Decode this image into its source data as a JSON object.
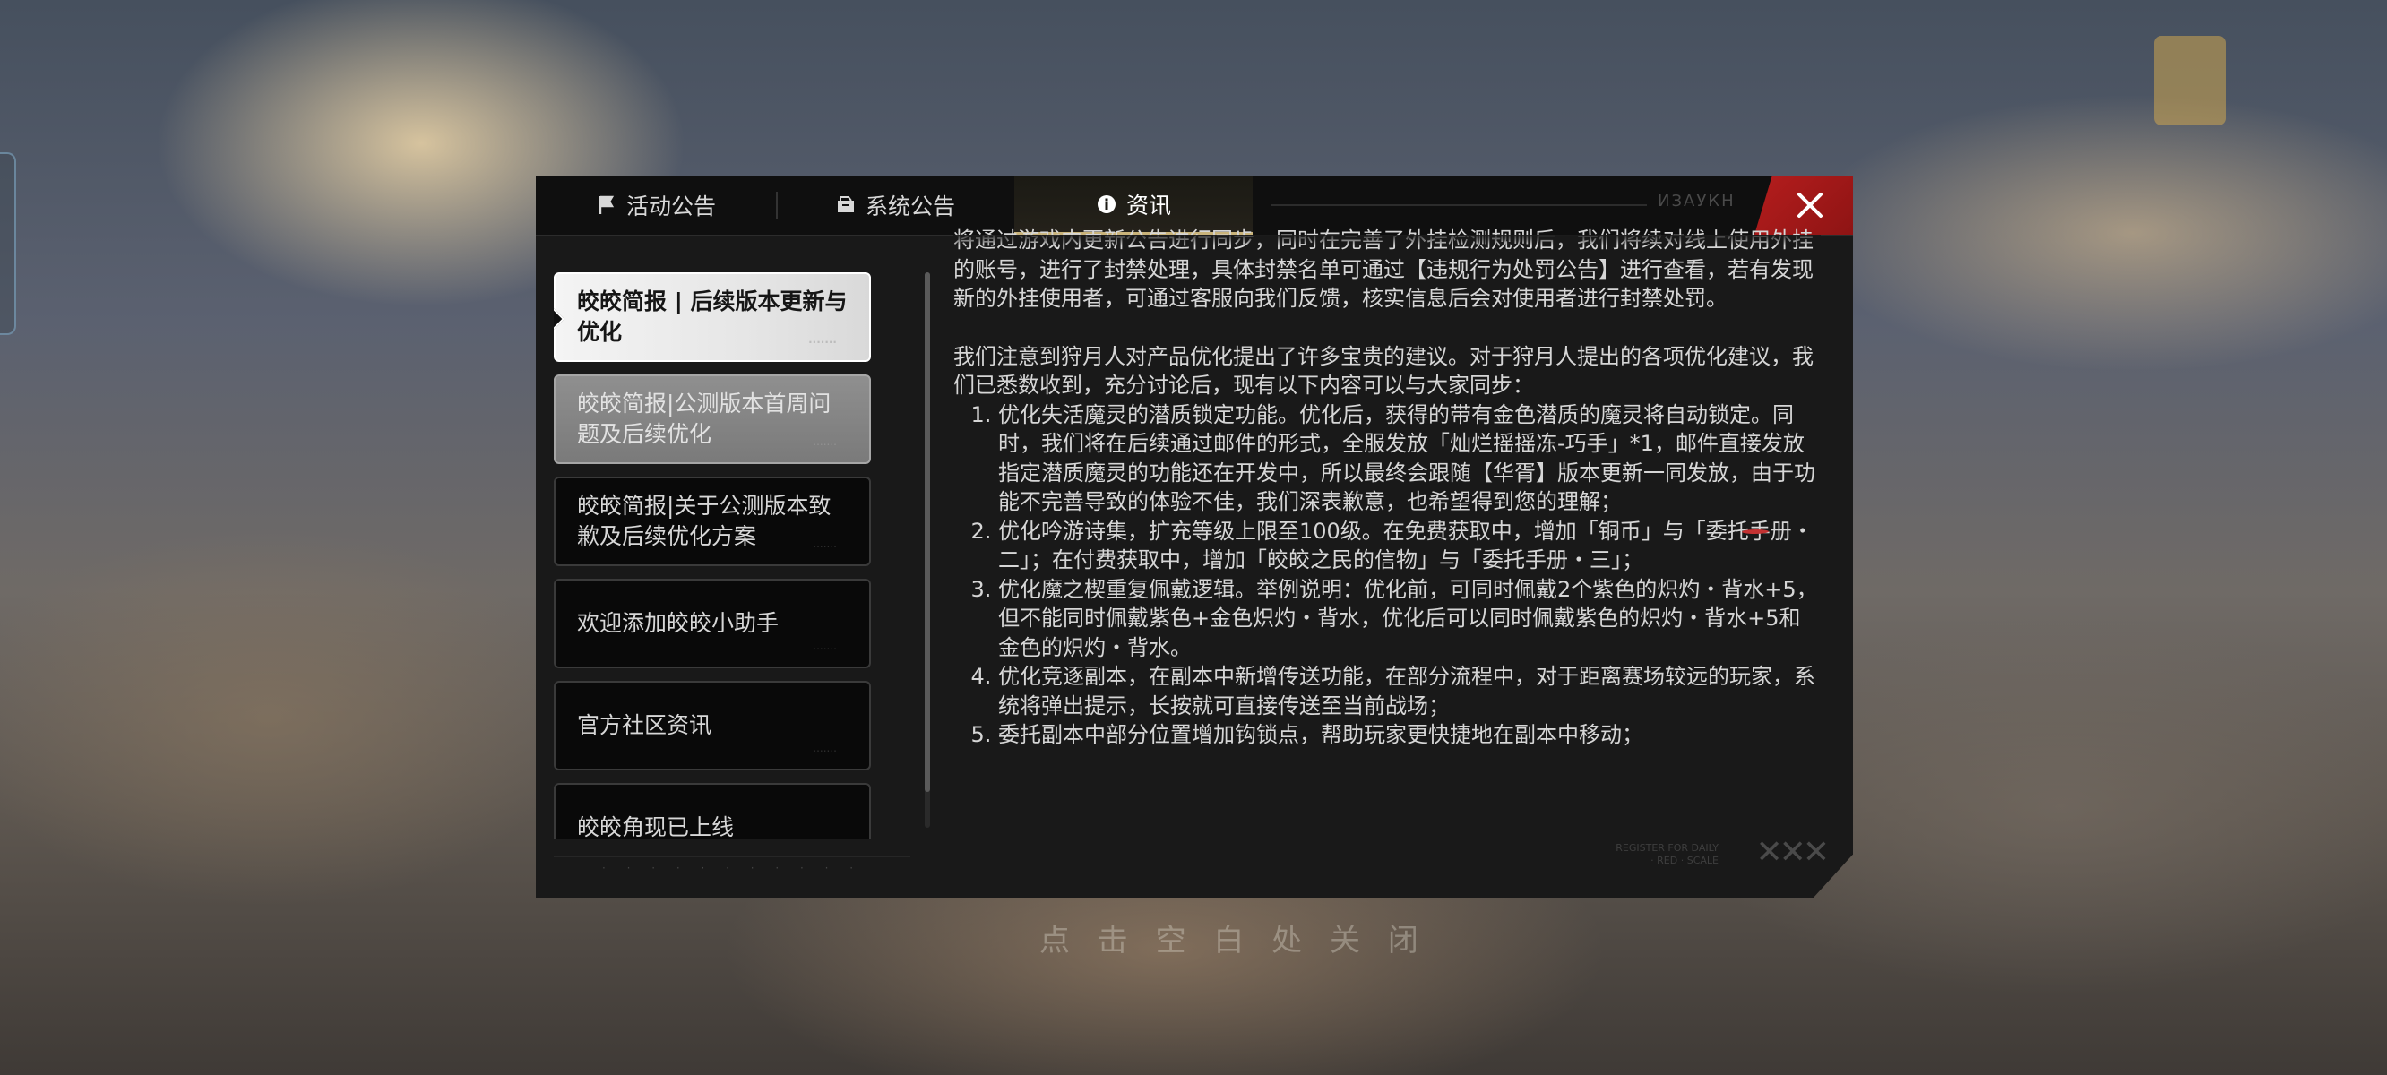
{
  "background": {
    "dim_label": "点 击 空 白 处 关 闭"
  },
  "tabs": [
    {
      "label": "活动公告",
      "icon": "flag-icon"
    },
    {
      "label": "系统公告",
      "icon": "envelope-icon"
    },
    {
      "label": "资讯",
      "icon": "info-icon",
      "active": true
    }
  ],
  "tab_deco_text": "ИЗАУКН",
  "close_icon": "close-icon",
  "list": {
    "items": [
      {
        "title": "皎皎简报 | 后续版本更新与优化",
        "state": "active"
      },
      {
        "title": "皎皎简报|公测版本首周问题及后续优化",
        "state": "read"
      },
      {
        "title": "皎皎简报|关于公测版本致歉及后续优化方案",
        "state": "normal"
      },
      {
        "title": "欢迎添加皎皎小助手",
        "state": "normal"
      },
      {
        "title": "官方社区资讯",
        "state": "normal"
      },
      {
        "title": "皎皎角现已上线",
        "state": "normal"
      }
    ],
    "footer_deco": "· · · · · · · · · · ·"
  },
  "content": {
    "para1": "将通过游戏内更新公告进行同步，同时在完善了外挂检测规则后，我们将续对线上使用外挂的账号，进行了封禁处理，具体封禁名单可通过【违规行为处罚公告】进行查看，若有发现新的外挂使用者，可通过客服向我们反馈，核实信息后会对使用者进行封禁处罚。",
    "para2": "我们注意到狩月人对产品优化提出了许多宝贵的建议。对于狩月人提出的各项优化建议，我们已悉数收到，充分讨论后，现有以下内容可以与大家同步：",
    "items": [
      {
        "before": "优化失活魔灵的潜质锁定功能。优化后，获得的带有金色潜质的魔灵将自动锁定。同时，我们将在后续通过邮件的形式，全服发放「灿烂摇摇冻-巧手」*1，邮件直接发放指定潜质魔灵的功能还在开发中，所以最终会跟随【华胥】版本更新一同发放，",
        "highlight": "由于功能不完善导致的体验不佳",
        "after": "，我们深表歉意，也希望得到您的理解；"
      },
      {
        "text": "优化吟游诗集，扩充等级上限至100级。在免费获取中，增加「铜币」与「委托手册・二」；在付费获取中，增加「皎皎之民的信物」与「委托手册・三」；"
      },
      {
        "text": "优化魔之楔重复佩戴逻辑。举例说明：优化前，可同时佩戴2个紫色的炽灼・背水+5，但不能同时佩戴紫色+金色炽灼・背水，优化后可以同时佩戴紫色的炽灼・背水+5和金色的炽灼・背水。"
      },
      {
        "text": "优化竞逐副本，在副本中新增传送功能，在部分流程中，对于距离赛场较远的玩家，系统将弹出提示，长按就可直接传送至当前战场；"
      },
      {
        "text": "委托副本中部分位置增加钩锁点，帮助玩家更快捷地在副本中移动；"
      }
    ]
  },
  "footer_deco": "REGISTER FOR DAILY · RED · SCALE",
  "colors": {
    "accent_gold": "#c9b37a",
    "close_red": "#b51d1d",
    "underline_red": "#c33232"
  }
}
